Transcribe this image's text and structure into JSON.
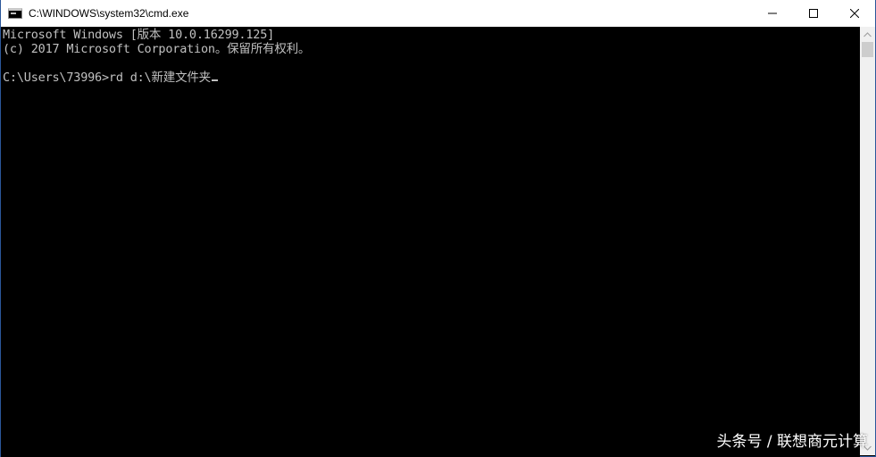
{
  "window": {
    "title": "C:\\WINDOWS\\system32\\cmd.exe",
    "app_icon": "console-app-icon"
  },
  "caption_buttons": {
    "minimize": "minimize-icon",
    "maximize": "maximize-icon",
    "close": "close-icon"
  },
  "console": {
    "lines": [
      "Microsoft Windows [版本 10.0.16299.125]",
      "(c) 2017 Microsoft Corporation。保留所有权利。",
      "",
      "C:\\Users\\73996>rd d:\\新建文件夹"
    ]
  },
  "watermark": {
    "text": "头条号 / 联想商元计算"
  },
  "colors": {
    "console_bg": "#000000",
    "console_text": "#c0c0c0",
    "titlebar_bg": "#ffffff",
    "scrollbar_bg": "#f0f0f0"
  }
}
